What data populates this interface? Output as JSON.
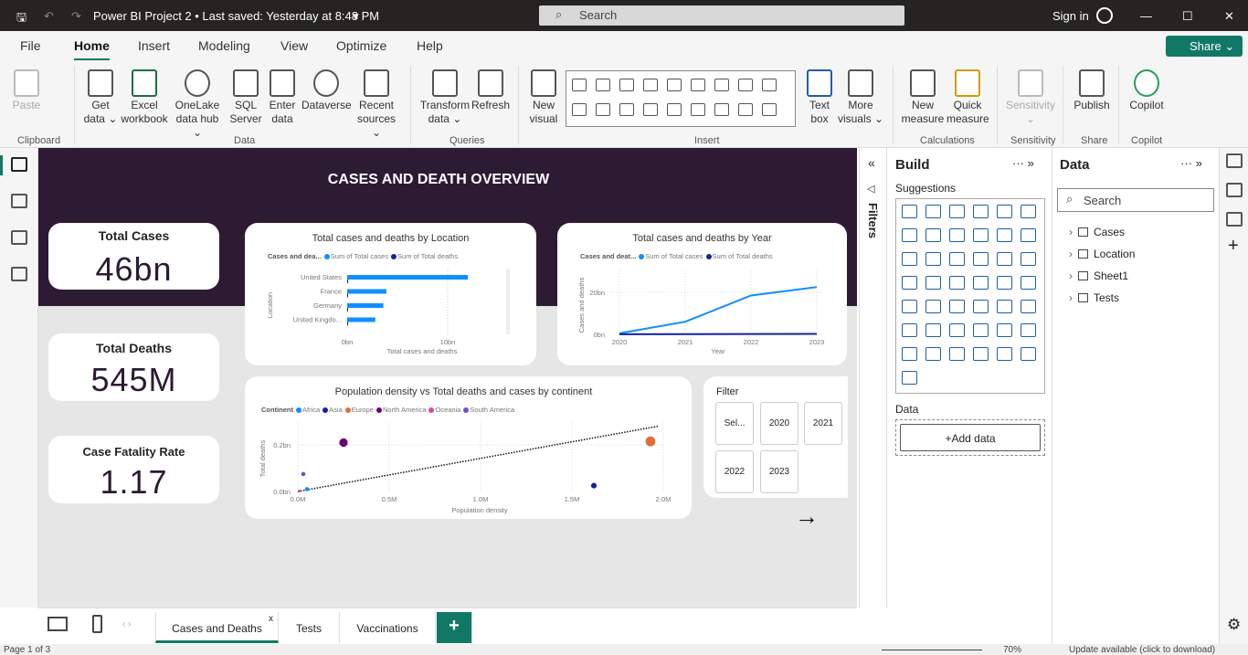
{
  "titlebar": {
    "title": "Power BI Project 2 • Last saved: Yesterday at 8:48 PM",
    "search_placeholder": "Search",
    "signin": "Sign in"
  },
  "menu": [
    "File",
    "Home",
    "Insert",
    "Modeling",
    "View",
    "Optimize",
    "Help"
  ],
  "share_label": "Share",
  "ribbon": {
    "buttons": [
      {
        "label": "Paste",
        "x": "paste"
      },
      {
        "label": "Get data ⌄"
      },
      {
        "label": "Excel workbook"
      },
      {
        "label": "OneLake data hub ⌄"
      },
      {
        "label": "SQL Server"
      },
      {
        "label": "Enter data"
      },
      {
        "label": "Dataverse"
      },
      {
        "label": "Recent sources ⌄"
      },
      {
        "label": "Transform data ⌄"
      },
      {
        "label": "Refresh"
      },
      {
        "label": "New visual"
      },
      {
        "label": "Text box"
      },
      {
        "label": "More visuals ⌄"
      },
      {
        "label": "New measure"
      },
      {
        "label": "Quick measure"
      },
      {
        "label": "Sensitivity ⌄"
      },
      {
        "label": "Publish"
      },
      {
        "label": "Copilot"
      }
    ],
    "groups": [
      "Clipboard",
      "Data",
      "Queries",
      "Insert",
      "Calculations",
      "Sensitivity",
      "Share",
      "Copilot"
    ]
  },
  "report": {
    "title": "CASES AND DEATH OVERVIEW",
    "kpis": [
      {
        "label": "Total Cases",
        "value": "46bn"
      },
      {
        "label": "Total Deaths",
        "value": "545M"
      },
      {
        "label": "Case Fatality Rate",
        "value": "1.17"
      }
    ],
    "slicer": {
      "title": "Filter",
      "items": [
        "Sel...",
        "2020",
        "2021",
        "2022",
        "2023"
      ]
    },
    "colors": {
      "cases": "#118dff",
      "deaths": "#12239e",
      "header": "#2d1a33"
    }
  },
  "chart_data": [
    {
      "type": "bar",
      "title": "Total cases and deaths by Location",
      "legend_title": "Cases and dea...",
      "series": [
        {
          "name": "Sum of Total cases",
          "values": [
            12,
            3.9,
            3.6,
            2.8
          ]
        },
        {
          "name": "Sum of Total deaths",
          "values": [
            0.1,
            0.02,
            0.02,
            0.02
          ]
        }
      ],
      "categories": [
        "United States",
        "France",
        "Germany",
        "United Kingdo..."
      ],
      "xlabel": "Total cases and deaths",
      "ylabel": "Location",
      "xticks": [
        "0bn",
        "10bn"
      ],
      "xlim": [
        0,
        15
      ]
    },
    {
      "type": "line",
      "title": "Total cases and deaths by Year",
      "legend_title": "Cases and deat...",
      "x": [
        "2020",
        "2021",
        "2022",
        "2023"
      ],
      "series": [
        {
          "name": "Sum of Total cases",
          "values": [
            0.5,
            6,
            18.5,
            22.5
          ]
        },
        {
          "name": "Sum of Total deaths",
          "values": [
            0.05,
            0.1,
            0.15,
            0.2
          ]
        }
      ],
      "xlabel": "Year",
      "ylabel": "Cases and deaths",
      "yticks": [
        "0bn",
        "20bn"
      ],
      "ylim": [
        0,
        30
      ]
    },
    {
      "type": "scatter",
      "title": "Population density vs Total deaths and cases by continent",
      "legend_title": "Continent",
      "xlabel": "Population density",
      "ylabel": "Total deaths",
      "xticks": [
        "0.0M",
        "0.5M",
        "1.0M",
        "1.5M",
        "2.0M"
      ],
      "yticks": [
        "0.0bn",
        "0.2bn"
      ],
      "xlim": [
        0,
        2
      ],
      "ylim": [
        0,
        0.3
      ],
      "points": [
        {
          "name": "Africa",
          "x": 0.05,
          "y": 0.01,
          "color": "#118dff",
          "size": 3
        },
        {
          "name": "Asia",
          "x": 1.62,
          "y": 0.025,
          "color": "#12239e",
          "size": 4
        },
        {
          "name": "Europe",
          "x": 1.93,
          "y": 0.215,
          "color": "#e66c37",
          "size": 7
        },
        {
          "name": "North America",
          "x": 0.25,
          "y": 0.21,
          "color": "#6b007b",
          "size": 6
        },
        {
          "name": "Oceania",
          "x": 0.01,
          "y": 0.002,
          "color": "#e044a7",
          "size": 2
        },
        {
          "name": "South America",
          "x": 0.03,
          "y": 0.075,
          "color": "#744ec2",
          "size": 3
        }
      ],
      "trend": [
        [
          0,
          0
        ],
        [
          1.97,
          0.28
        ]
      ]
    }
  ],
  "filters_label": "Filters",
  "build": {
    "title": "Build",
    "suggestions": "Suggestions",
    "data_label": "Data",
    "add_data": "+Add data"
  },
  "data_pane": {
    "title": "Data",
    "search_placeholder": "Search",
    "tables": [
      "Cases",
      "Location",
      "Sheet1",
      "Tests"
    ]
  },
  "pages": {
    "tabs": [
      "Cases and Deaths",
      "Tests",
      "Vaccinations"
    ],
    "add": "+"
  },
  "status": {
    "page": "Page 1 of 3",
    "zoom": "70%",
    "update": "Update available (click to download)"
  }
}
